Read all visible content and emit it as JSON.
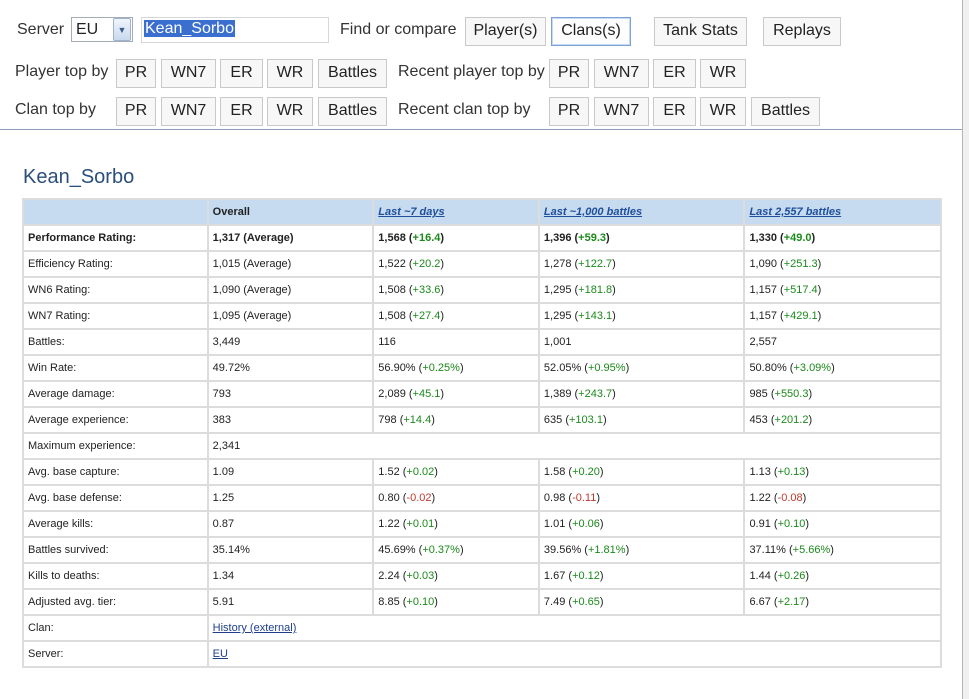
{
  "toolbar": {
    "server_label": "Server",
    "server_value": "EU",
    "player_name": "Kean_Sorbo",
    "find_label": "Find or compare",
    "players_button": "Player(s)",
    "clans_button": "Clans(s)",
    "tank_stats_button": "Tank Stats",
    "replays_button": "Replays"
  },
  "player_top": {
    "label": "Player top by",
    "buttons": [
      "PR",
      "WN7",
      "ER",
      "WR",
      "Battles"
    ],
    "recent_label": "Recent player top by",
    "recent_buttons": [
      "PR",
      "WN7",
      "ER",
      "WR"
    ]
  },
  "clan_top": {
    "label": "Clan top by",
    "buttons": [
      "PR",
      "WN7",
      "ER",
      "WR",
      "Battles"
    ],
    "recent_label": "Recent clan top by",
    "recent_buttons": [
      "PR",
      "WN7",
      "ER",
      "WR",
      "Battles"
    ]
  },
  "player": {
    "title": "Kean_Sorbo"
  },
  "table": {
    "headers": [
      "",
      "Overall",
      "Last ~7 days",
      "Last ~1,000 battles",
      "Last 2,557 battles"
    ],
    "rows": [
      {
        "label": "Performance Rating:",
        "cells": [
          {
            "v": "1,317 (Average)"
          },
          {
            "v": "1,568 (",
            "d": "+16.4",
            "s": "pos"
          },
          {
            "v": "1,396 (",
            "d": "+59.3",
            "s": "pos"
          },
          {
            "v": "1,330 (",
            "d": "+49.0",
            "s": "pos"
          }
        ]
      },
      {
        "label": "Efficiency Rating:",
        "cells": [
          {
            "v": "1,015 (Average)"
          },
          {
            "v": "1,522 (",
            "d": "+20.2",
            "s": "pos"
          },
          {
            "v": "1,278 (",
            "d": "+122.7",
            "s": "pos"
          },
          {
            "v": "1,090 (",
            "d": "+251.3",
            "s": "pos"
          }
        ]
      },
      {
        "label": "WN6 Rating:",
        "cells": [
          {
            "v": "1,090 (Average)"
          },
          {
            "v": "1,508 (",
            "d": "+33.6",
            "s": "pos"
          },
          {
            "v": "1,295 (",
            "d": "+181.8",
            "s": "pos"
          },
          {
            "v": "1,157 (",
            "d": "+517.4",
            "s": "pos"
          }
        ]
      },
      {
        "label": "WN7 Rating:",
        "cells": [
          {
            "v": "1,095 (Average)"
          },
          {
            "v": "1,508 (",
            "d": "+27.4",
            "s": "pos"
          },
          {
            "v": "1,295 (",
            "d": "+143.1",
            "s": "pos"
          },
          {
            "v": "1,157 (",
            "d": "+429.1",
            "s": "pos"
          }
        ]
      },
      {
        "label": "Battles:",
        "cells": [
          {
            "v": "3,449"
          },
          {
            "v": "116"
          },
          {
            "v": "1,001"
          },
          {
            "v": "2,557"
          }
        ]
      },
      {
        "label": "Win Rate:",
        "cells": [
          {
            "v": "49.72%"
          },
          {
            "v": "56.90% (",
            "d": "+0.25%",
            "s": "pos"
          },
          {
            "v": "52.05% (",
            "d": "+0.95%",
            "s": "pos"
          },
          {
            "v": "50.80% (",
            "d": "+3.09%",
            "s": "pos"
          }
        ]
      },
      {
        "label": "Average damage:",
        "cells": [
          {
            "v": "793"
          },
          {
            "v": "2,089 (",
            "d": "+45.1",
            "s": "pos"
          },
          {
            "v": "1,389 (",
            "d": "+243.7",
            "s": "pos"
          },
          {
            "v": "985 (",
            "d": "+550.3",
            "s": "pos"
          }
        ]
      },
      {
        "label": "Average experience:",
        "cells": [
          {
            "v": "383"
          },
          {
            "v": "798 (",
            "d": "+14.4",
            "s": "pos"
          },
          {
            "v": "635 (",
            "d": "+103.1",
            "s": "pos"
          },
          {
            "v": "453 (",
            "d": "+201.2",
            "s": "pos"
          }
        ]
      },
      {
        "label": "Maximum experience:",
        "span": "2,341"
      },
      {
        "label": "Avg. base capture:",
        "cells": [
          {
            "v": "1.09"
          },
          {
            "v": "1.52 (",
            "d": "+0.02",
            "s": "pos"
          },
          {
            "v": "1.58 (",
            "d": "+0.20",
            "s": "pos"
          },
          {
            "v": "1.13 (",
            "d": "+0.13",
            "s": "pos"
          }
        ]
      },
      {
        "label": "Avg. base defense:",
        "cells": [
          {
            "v": "1.25"
          },
          {
            "v": "0.80 (",
            "d": "-0.02",
            "s": "neg"
          },
          {
            "v": "0.98 (",
            "d": "-0.11",
            "s": "neg"
          },
          {
            "v": "1.22 (",
            "d": "-0.08",
            "s": "neg"
          }
        ]
      },
      {
        "label": "Average kills:",
        "cells": [
          {
            "v": "0.87"
          },
          {
            "v": "1.22 (",
            "d": "+0.01",
            "s": "pos"
          },
          {
            "v": "1.01 (",
            "d": "+0.06",
            "s": "pos"
          },
          {
            "v": "0.91 (",
            "d": "+0.10",
            "s": "pos"
          }
        ]
      },
      {
        "label": "Battles survived:",
        "cells": [
          {
            "v": "35.14%"
          },
          {
            "v": "45.69% (",
            "d": "+0.37%",
            "s": "pos"
          },
          {
            "v": "39.56% (",
            "d": "+1.81%",
            "s": "pos"
          },
          {
            "v": "37.11% (",
            "d": "+5.66%",
            "s": "pos"
          }
        ]
      },
      {
        "label": "Kills to deaths:",
        "cells": [
          {
            "v": "1.34"
          },
          {
            "v": "2.24 (",
            "d": "+0.03",
            "s": "pos"
          },
          {
            "v": "1.67 (",
            "d": "+0.12",
            "s": "pos"
          },
          {
            "v": "1.44 (",
            "d": "+0.26",
            "s": "pos"
          }
        ]
      },
      {
        "label": "Adjusted avg. tier:",
        "cells": [
          {
            "v": "5.91"
          },
          {
            "v": "8.85 (",
            "d": "+0.10",
            "s": "pos"
          },
          {
            "v": "7.49 (",
            "d": "+0.65",
            "s": "pos"
          },
          {
            "v": "6.67 (",
            "d": "+2.17",
            "s": "pos"
          }
        ]
      },
      {
        "label": "Clan:",
        "span": "History (external)",
        "link": true
      },
      {
        "label": "Server:",
        "span": "EU",
        "link": true
      }
    ]
  }
}
